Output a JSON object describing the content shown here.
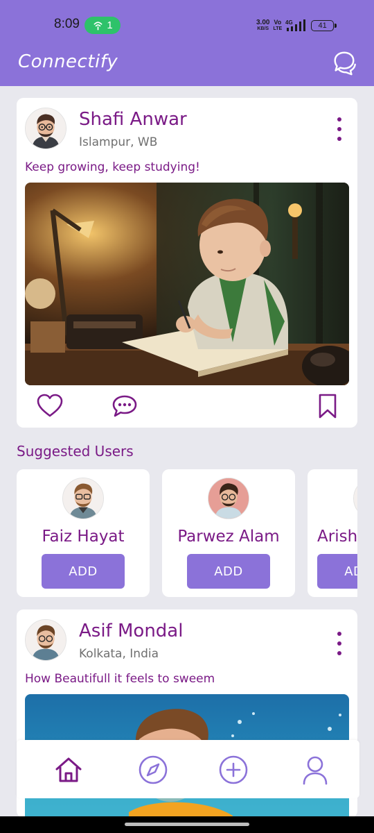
{
  "status_bar": {
    "time": "8:09",
    "call_count": "1",
    "speed_value": "3.00",
    "speed_unit": "KB/S",
    "volte_top": "Vo",
    "volte_bottom": "LTE",
    "network": "4G",
    "battery": "41"
  },
  "app_bar": {
    "title": "Connectify",
    "chat_icon": "chat-bubbles-icon"
  },
  "posts": [
    {
      "author": "Shafi Anwar",
      "location": "Islampur, WB",
      "caption": "Keep growing, keep studying!",
      "image_alt": "boy-studying-illustration"
    },
    {
      "author": "Asif Mondal",
      "location": "Kolkata, India",
      "caption": "How Beautifull it feels to sweem",
      "image_alt": "man-swimming-illustration"
    }
  ],
  "suggested": {
    "title": "Suggested Users",
    "users": [
      {
        "name": "Faiz Hayat",
        "button": "ADD"
      },
      {
        "name": "Parwez Alam",
        "button": "ADD"
      },
      {
        "name": "Arish",
        "button": "ADD"
      }
    ]
  },
  "bottom_nav": {
    "items": [
      "home-icon",
      "explore-compass-icon",
      "add-post-icon",
      "profile-icon"
    ]
  },
  "colors": {
    "primary": "#8b72d9",
    "accent_text": "#7a1a86",
    "background": "#e8e8ee",
    "card": "#ffffff"
  }
}
